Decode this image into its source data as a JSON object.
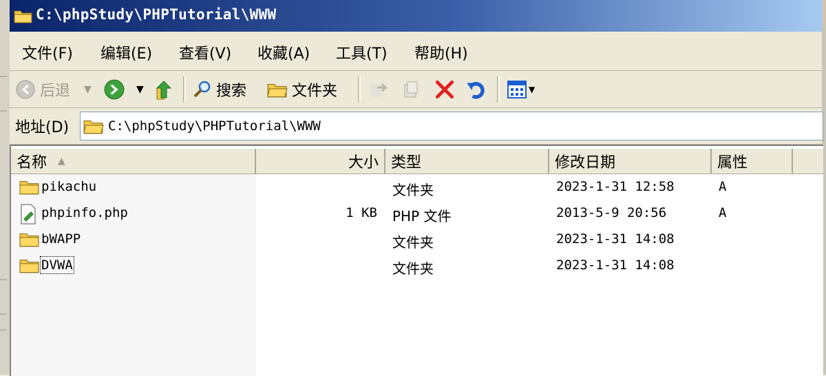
{
  "window": {
    "title": "C:\\phpStudy\\PHPTutorial\\WWW"
  },
  "menu": [
    "文件(F)",
    "编辑(E)",
    "查看(V)",
    "收藏(A)",
    "工具(T)",
    "帮助(H)"
  ],
  "toolbar": {
    "back": "后退",
    "search": "搜索",
    "folders": "文件夹"
  },
  "address": {
    "label": "地址(D)",
    "path": "C:\\phpStudy\\PHPTutorial\\WWW"
  },
  "columns": {
    "name": "名称",
    "size": "大小",
    "type": "类型",
    "modified": "修改日期",
    "attributes": "属性"
  },
  "files": [
    {
      "name": "pikachu",
      "size": "",
      "type": "文件夹",
      "modified": "2023-1-31 12:58",
      "attr": "A",
      "icon": "folder-icon"
    },
    {
      "name": "phpinfo.php",
      "size": "1 KB",
      "type": "PHP 文件",
      "modified": "2013-5-9 20:56",
      "attr": "A",
      "icon": "php-file-icon"
    },
    {
      "name": "bWAPP",
      "size": "",
      "type": "文件夹",
      "modified": "2023-1-31 14:08",
      "attr": "",
      "icon": "folder-icon"
    },
    {
      "name": "DVWA",
      "size": "",
      "type": "文件夹",
      "modified": "2023-1-31 14:08",
      "attr": "",
      "icon": "folder-icon"
    }
  ],
  "colors": {
    "title_start": "#0a246a",
    "title_end": "#a6caf0",
    "chrome": "#ece9d8",
    "delete_red": "#e02020"
  }
}
